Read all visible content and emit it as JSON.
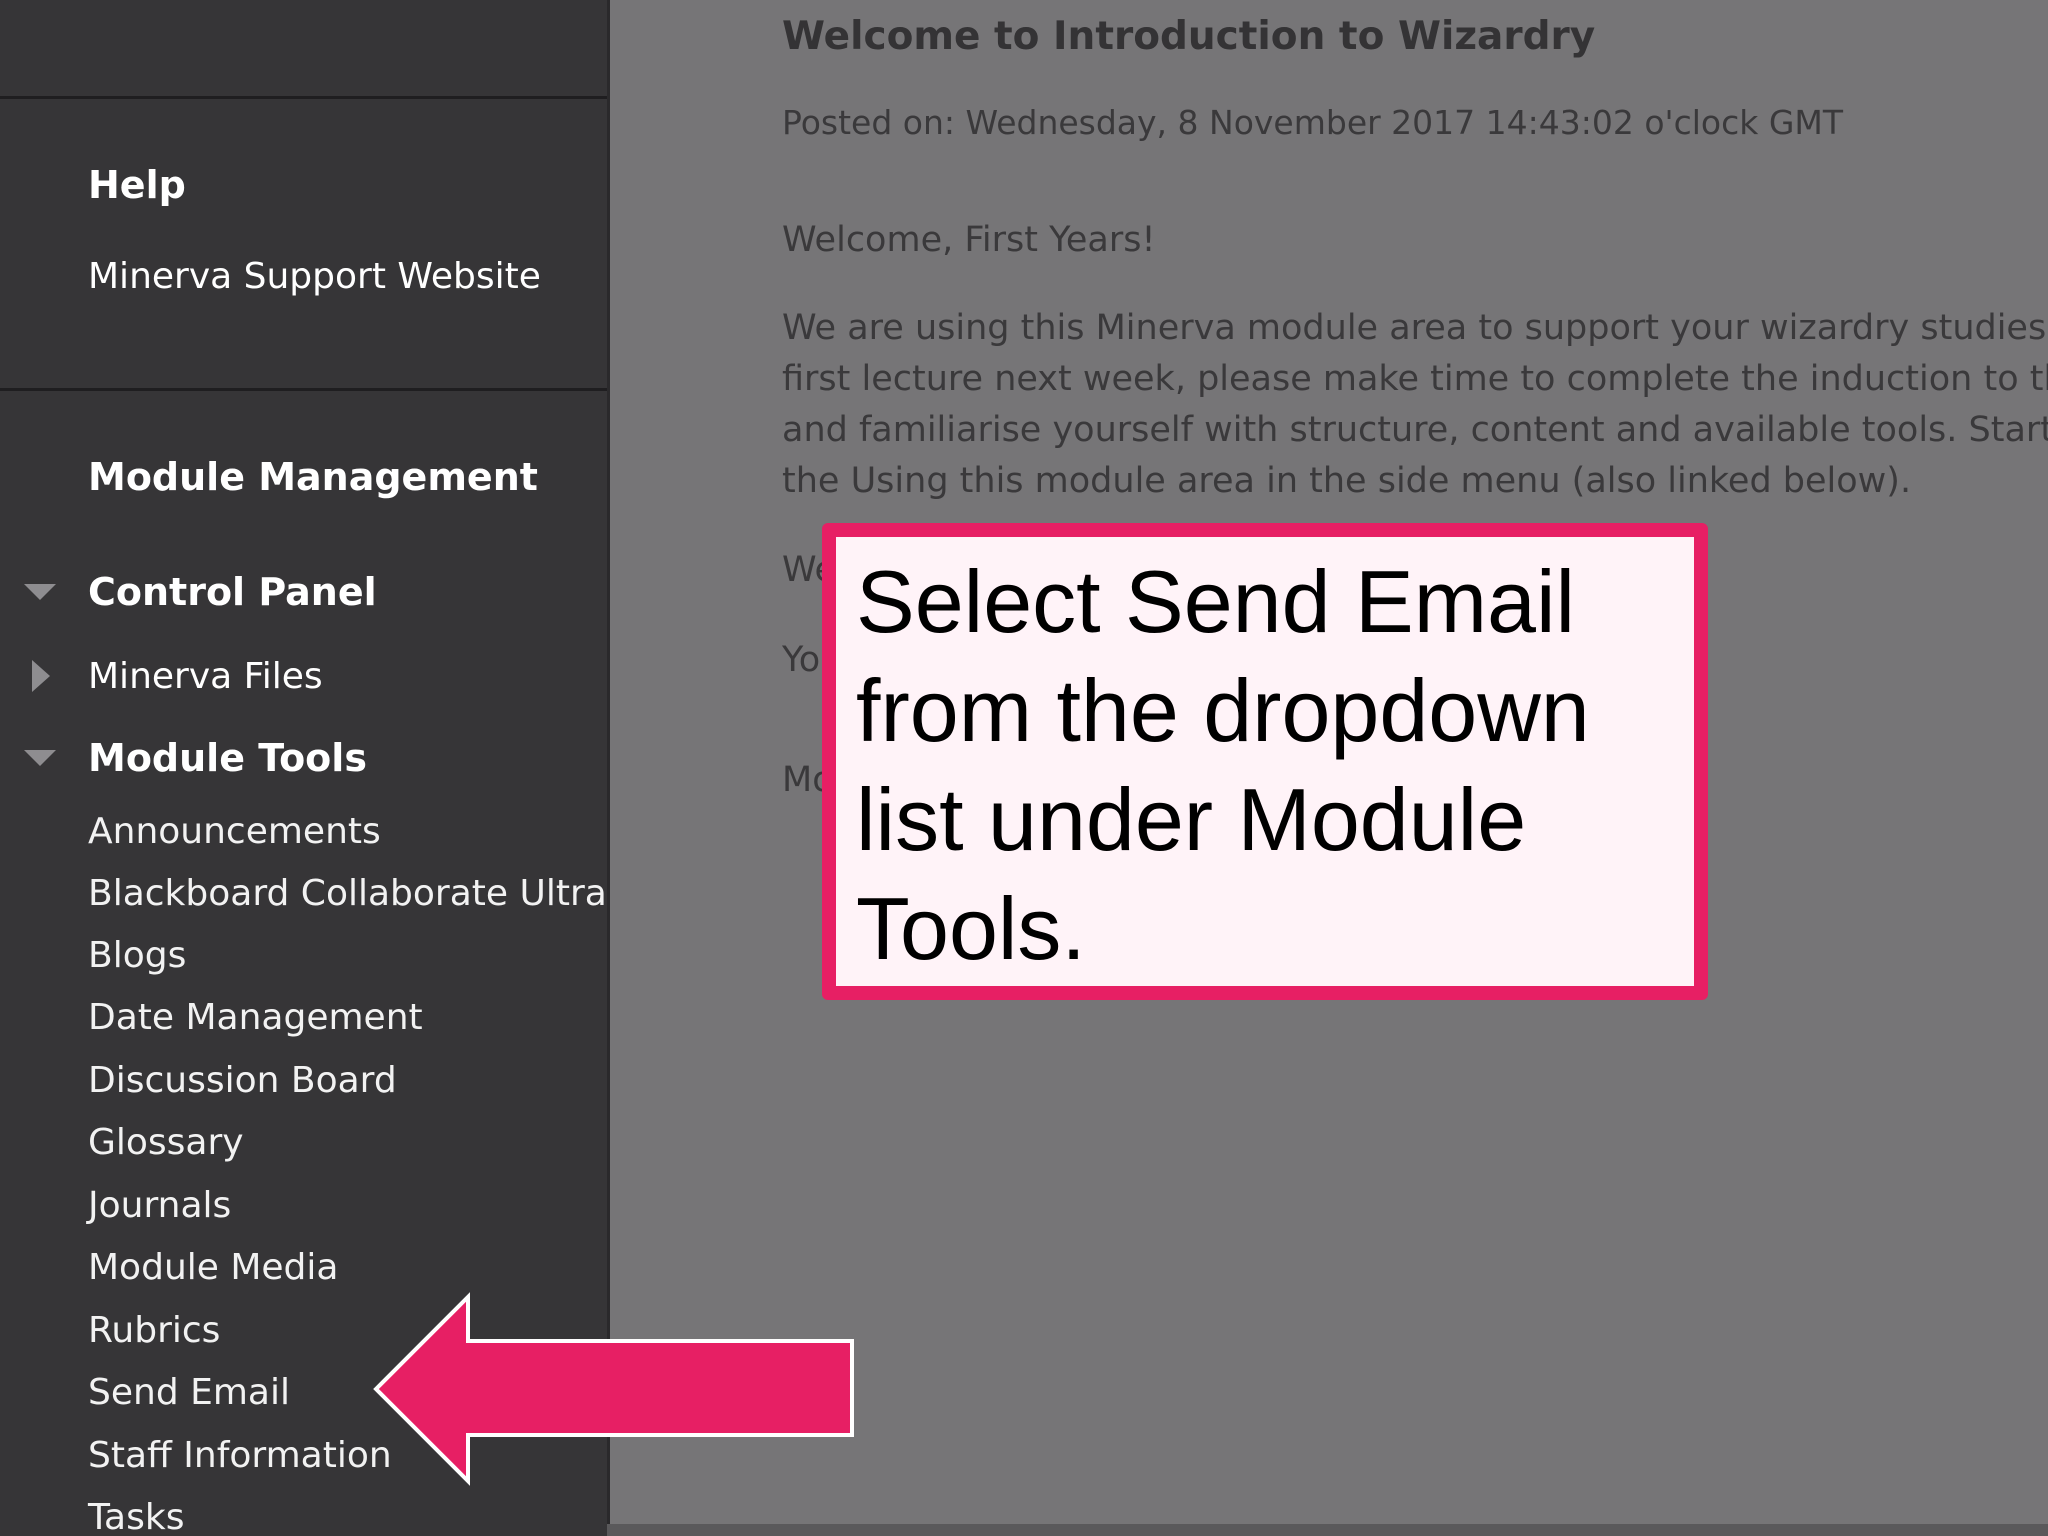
{
  "sidebar": {
    "help": {
      "heading": "Help",
      "support_link": "Minerva Support Website"
    },
    "module_management": {
      "heading": "Module Management",
      "control_panel": "Control Panel",
      "minerva_files": "Minerva Files",
      "module_tools": "Module Tools",
      "tools": [
        "Announcements",
        "Blackboard Collaborate Ultra",
        "Blogs",
        "Date Management",
        "Discussion Board",
        "Glossary",
        "Journals",
        "Module Media",
        "Rubrics",
        "Send Email",
        "Staff Information",
        "Tasks"
      ]
    }
  },
  "announcement": {
    "title": "Welcome to Introduction to Wizardry",
    "posted_on": "Posted on: Wednesday, 8 November 2017 14:43:02 o'clock GMT",
    "greeting": "Welcome, First Years!",
    "body_lines": [
      "We are using this Minerva module area to support your wizardry studies",
      "first lecture next week, please make time to complete the induction to th",
      "and familiarise yourself with structure, content and available tools. Start",
      "the Using this module area in the side menu (also linked below)."
    ],
    "peek_fragments": [
      "We",
      "Yo",
      "Mo"
    ]
  },
  "callout": {
    "text": "Select Send Email\nfrom the dropdown\nlist under Module\nTools."
  },
  "colors": {
    "accent": "#e71f64",
    "sidebar_bg": "#363537",
    "content_bg": "#767577"
  }
}
